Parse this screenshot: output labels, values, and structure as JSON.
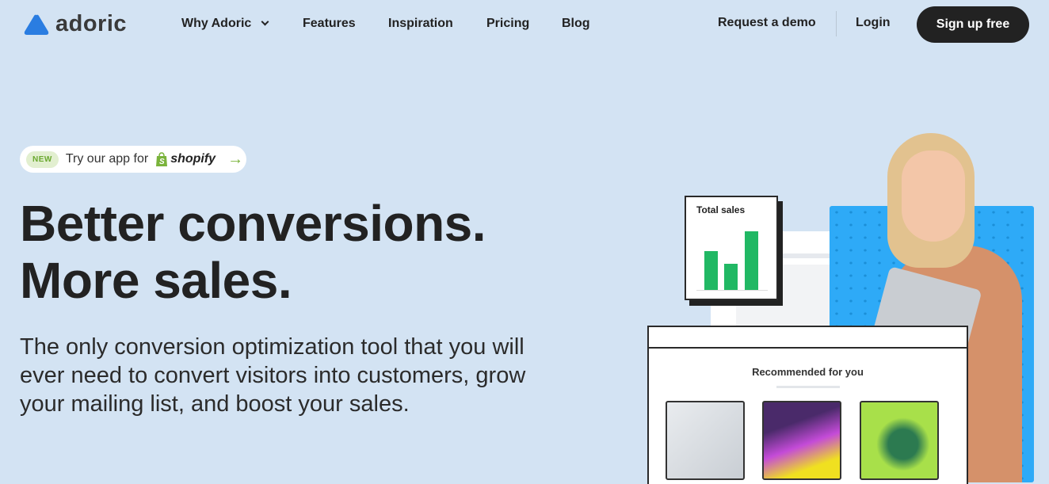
{
  "brand": {
    "name": "adoric",
    "logo_color": "#2a7de1"
  },
  "nav": {
    "items": [
      "Why Adoric",
      "Features",
      "Inspiration",
      "Pricing",
      "Blog"
    ],
    "request_demo": "Request a demo",
    "login": "Login",
    "signup": "Sign up free"
  },
  "badge": {
    "tag": "NEW",
    "text": "Try our app for",
    "brand": "shopify"
  },
  "hero": {
    "title_line1": "Better conversions.",
    "title_line2": "More sales.",
    "subtitle": "The only conversion optimization tool that you will ever need to convert visitors into customers, grow your mailing list, and boost your sales."
  },
  "illustration": {
    "sales_card_title": "Total sales",
    "recommend_title": "Recommended for you",
    "accent": "#21b864",
    "panel_color": "#2eaaf7"
  }
}
